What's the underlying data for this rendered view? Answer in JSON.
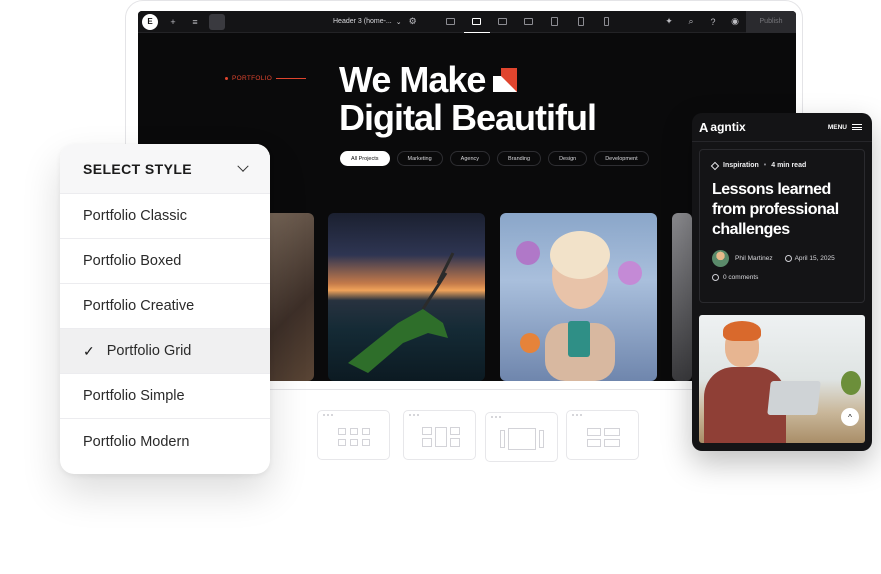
{
  "editor": {
    "doc_title": "Header 3 (home-...",
    "publish_label": "Publish",
    "device_icons": [
      "desktop-icon",
      "laptop-icon",
      "tablet-landscape-icon",
      "tablet-icon",
      "mobile-landscape-icon",
      "mobile-icon"
    ]
  },
  "hero": {
    "tag": "PORTFOLIO",
    "title_line1": "We Make",
    "title_line2": "Digital Beautiful",
    "accent_color": "#e0452e",
    "filters": [
      "All Projects",
      "Marketing",
      "Agency",
      "Branding",
      "Design",
      "Development"
    ],
    "active_filter": "All Projects"
  },
  "select_style": {
    "heading": "SELECT STYLE",
    "options": [
      {
        "label": "Portfolio Classic",
        "selected": false
      },
      {
        "label": "Portfolio Boxed",
        "selected": false
      },
      {
        "label": "Portfolio Creative",
        "selected": false
      },
      {
        "label": "Portfolio Grid",
        "selected": true
      },
      {
        "label": "Portfolio Simple",
        "selected": false
      },
      {
        "label": "Portfolio Modern",
        "selected": false
      }
    ],
    "check_mark": "✓"
  },
  "phone": {
    "logo": "agntix",
    "logo_initial": "A",
    "menu_label": "MENU",
    "post": {
      "category": "Inspiration",
      "read_time": "4 min read",
      "title": "Lessons learned from professional challenges",
      "author": "Phil Martinez",
      "date": "April 15, 2025",
      "comments": "0 comments"
    },
    "scroll_top_glyph": "^"
  }
}
